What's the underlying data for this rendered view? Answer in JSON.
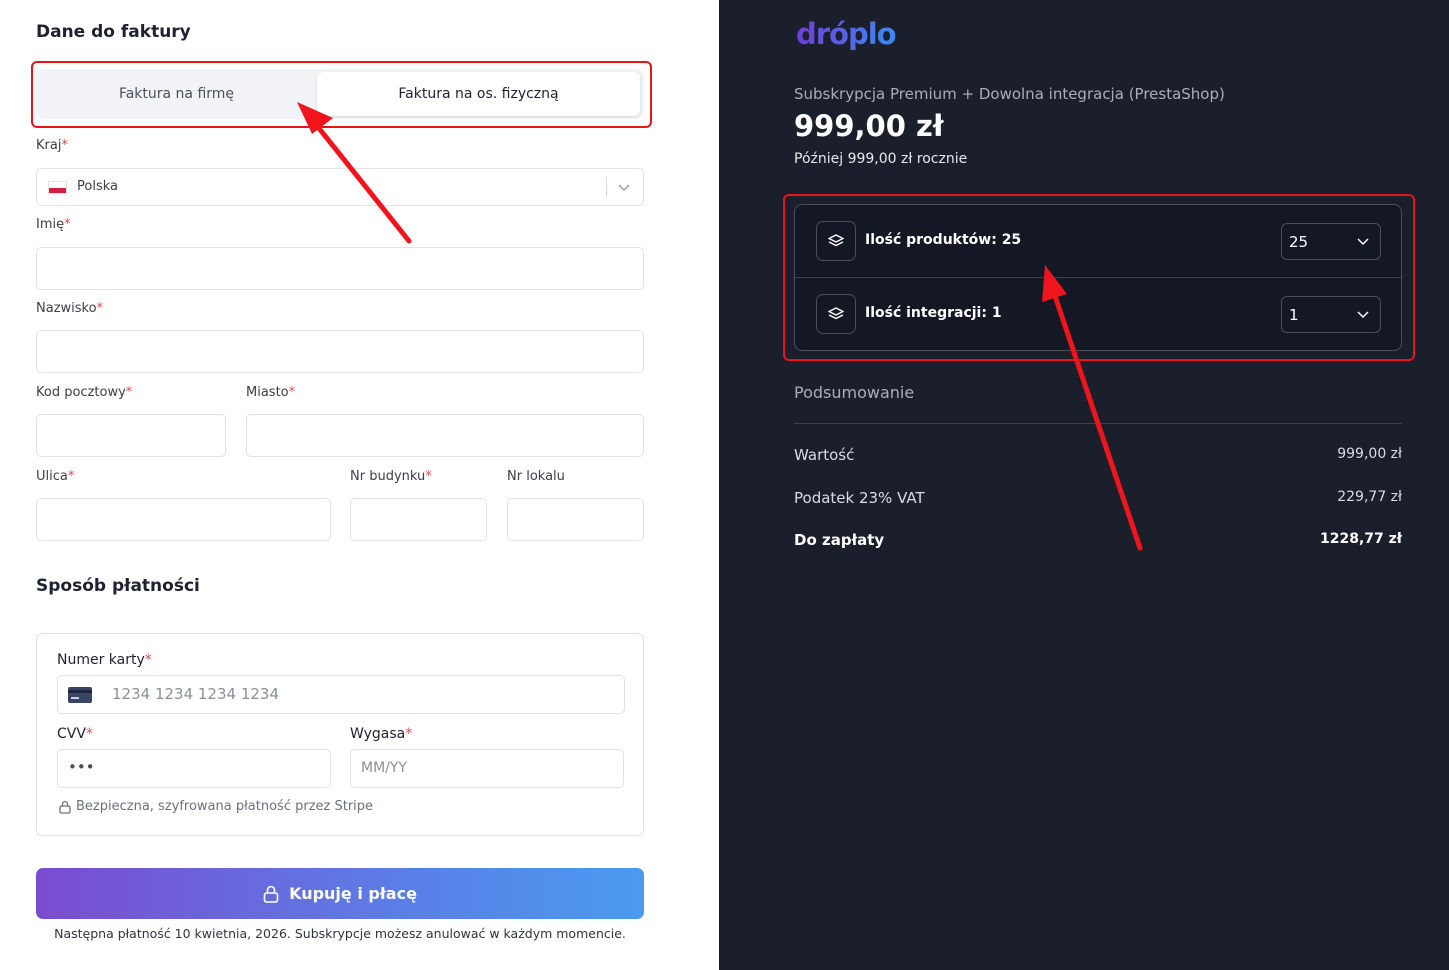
{
  "billing": {
    "title": "Dane do faktury",
    "toggle": {
      "company": "Faktura na firmę",
      "private": "Faktura na os. fizyczną",
      "selected": "private"
    },
    "country": {
      "label": "Kraj",
      "value": "Polska"
    },
    "first_name": {
      "label": "Imię"
    },
    "last_name": {
      "label": "Nazwisko"
    },
    "postal_code": {
      "label": "Kod pocztowy"
    },
    "city": {
      "label": "Miasto"
    },
    "street": {
      "label": "Ulica"
    },
    "building": {
      "label": "Nr budynku"
    },
    "apartment": {
      "label": "Nr lokalu"
    },
    "required_mark": "*"
  },
  "payment": {
    "title": "Sposób płatności",
    "card_number": {
      "label": "Numer karty",
      "placeholder": "1234 1234 1234 1234"
    },
    "cvv": {
      "label": "CVV",
      "placeholder": "•••"
    },
    "expiry": {
      "label": "Wygasa",
      "placeholder": "MM/YY"
    },
    "secure_note": "Bezpieczna, szyfrowana płatność przez Stripe",
    "buy_button": "Kupuję i płacę",
    "footer_note": "Następna płatność 10 kwietnia, 2026. Subskrypcje możesz anulować w każdym momencie."
  },
  "order": {
    "logo": "dróplo",
    "plan": "Subskrypcja Premium + Dowolna integracja (PrestaShop)",
    "price": "999,00 zł",
    "later": "Później 999,00 zł rocznie",
    "options": [
      {
        "label": "Ilość produktów: 25",
        "value": "25"
      },
      {
        "label": "Ilość integracji: 1",
        "value": "1"
      }
    ],
    "summary": {
      "title": "Podsumowanie",
      "rows": [
        {
          "label": "Wartość",
          "value": "999,00 zł"
        },
        {
          "label": "Podatek 23% VAT",
          "value": "229,77 zł"
        },
        {
          "label": "Do zapłaty",
          "value": "1228,77 zł"
        }
      ]
    }
  },
  "colors": {
    "accent_red": "#e8131b",
    "dark_bg": "#1b1f2b",
    "gradient_start": "#7b4cd0",
    "gradient_end": "#4a9bf0"
  }
}
